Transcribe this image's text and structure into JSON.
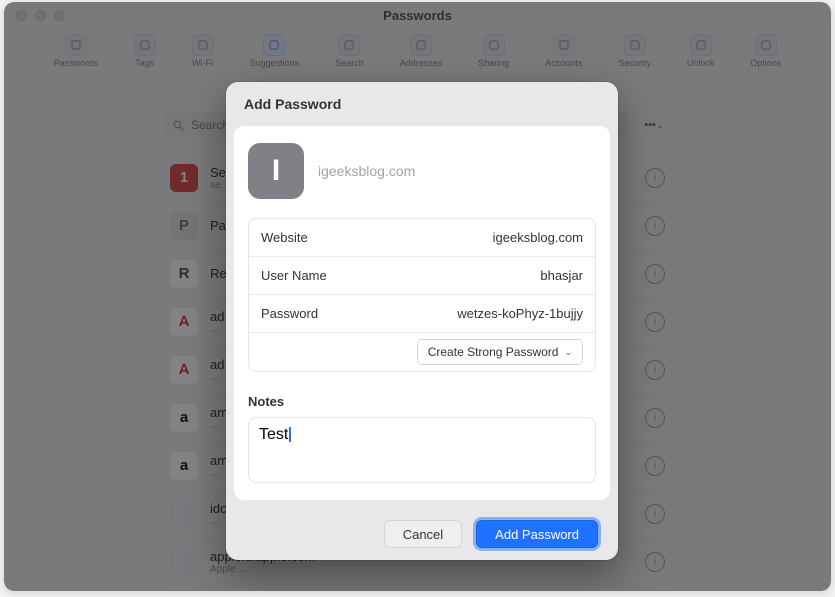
{
  "window": {
    "title": "Passwords"
  },
  "toolbar": {
    "items": [
      {
        "label": "Passwords"
      },
      {
        "label": "Tags"
      },
      {
        "label": "Wi-Fi"
      },
      {
        "label": "Suggestions"
      },
      {
        "label": "Search"
      },
      {
        "label": "Addresses"
      },
      {
        "label": "Sharing"
      },
      {
        "label": "Accounts"
      },
      {
        "label": "Security"
      },
      {
        "label": "Unlock"
      },
      {
        "label": "Options"
      }
    ],
    "active_index": 3
  },
  "search": {
    "placeholder": "Search"
  },
  "more_button": {
    "label": "•••"
  },
  "list": {
    "items": [
      {
        "title": "Se",
        "subtitle": "se…",
        "icon_text": "1",
        "icon_bg": "#d83b3b",
        "icon_fg": "#ffffff"
      },
      {
        "title": "Pa",
        "subtitle": "",
        "icon_text": "P",
        "icon_bg": "#dedee1",
        "icon_fg": "#666"
      },
      {
        "title": "Re",
        "subtitle": "",
        "icon_text": "R",
        "icon_bg": "#ffffff",
        "icon_fg": "#444"
      },
      {
        "title": "ad",
        "subtitle": "…",
        "icon_text": "A",
        "icon_bg": "#ffffff",
        "icon_fg": "#e1251b"
      },
      {
        "title": "ad",
        "subtitle": "…",
        "icon_text": "A",
        "icon_bg": "#ffffff",
        "icon_fg": "#e1251b"
      },
      {
        "title": "am",
        "subtitle": "…",
        "icon_text": "a",
        "icon_bg": "#ffffff",
        "icon_fg": "#000"
      },
      {
        "title": "am",
        "subtitle": "…",
        "icon_text": "a",
        "icon_bg": "#ffffff",
        "icon_fg": "#000"
      },
      {
        "title": "idc",
        "subtitle": "…",
        "icon_text": "",
        "icon_bg": "#e7e7ea",
        "icon_fg": "#666"
      },
      {
        "title": "appleid.apple.com",
        "subtitle": "Apple …",
        "icon_text": "",
        "icon_bg": "#e7e7ea",
        "icon_fg": "#666"
      }
    ]
  },
  "sheet": {
    "title": "Add Password",
    "identity_site": "igeeksblog.com",
    "identity_initial": "I",
    "fields": {
      "website_label": "Website",
      "website_value": "igeeksblog.com",
      "username_label": "User Name",
      "username_value": "bhasjar",
      "password_label": "Password",
      "password_value": "wetzes-koPhyz-1bujjy",
      "strong_label": "Create Strong Password"
    },
    "notes_label": "Notes",
    "notes_value": "Test",
    "cancel_label": "Cancel",
    "submit_label": "Add Password"
  }
}
